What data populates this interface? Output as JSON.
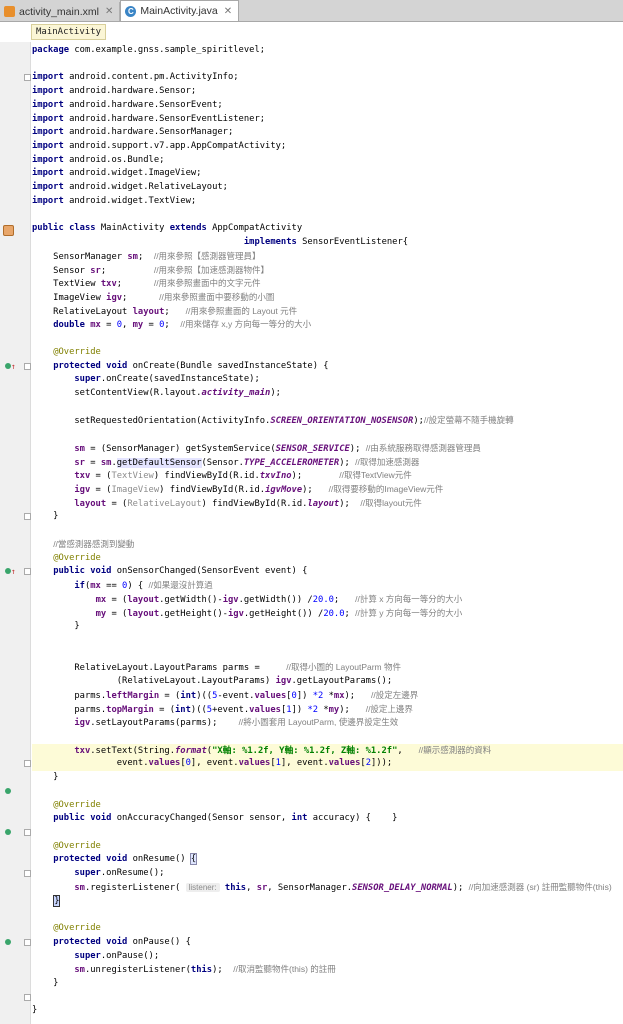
{
  "tabs": [
    {
      "label": "activity_main.xml",
      "icon": "xml-file-icon",
      "active": false
    },
    {
      "label": "MainActivity.java",
      "icon": "java-class-icon",
      "active": true
    }
  ],
  "breadcrumb": "MainActivity",
  "code_lines": [
    [
      {
        "t": "package ",
        "c": "k"
      },
      {
        "t": "com.example.gnss.sample_spiritlevel;"
      }
    ],
    [],
    [
      {
        "t": "import ",
        "c": "k"
      },
      {
        "t": "android.content.pm.ActivityInfo;"
      }
    ],
    [
      {
        "t": "import ",
        "c": "k"
      },
      {
        "t": "android.hardware.Sensor;"
      }
    ],
    [
      {
        "t": "import ",
        "c": "k"
      },
      {
        "t": "android.hardware.SensorEvent;"
      }
    ],
    [
      {
        "t": "import ",
        "c": "k"
      },
      {
        "t": "android.hardware.SensorEventListener;"
      }
    ],
    [
      {
        "t": "import ",
        "c": "k"
      },
      {
        "t": "android.hardware.SensorManager;"
      }
    ],
    [
      {
        "t": "import ",
        "c": "k"
      },
      {
        "t": "android.support.v7.app.AppCompatActivity;"
      }
    ],
    [
      {
        "t": "import ",
        "c": "k"
      },
      {
        "t": "android.os.Bundle;"
      }
    ],
    [
      {
        "t": "import ",
        "c": "k"
      },
      {
        "t": "android.widget.ImageView;"
      }
    ],
    [
      {
        "t": "import ",
        "c": "k"
      },
      {
        "t": "android.widget.RelativeLayout;"
      }
    ],
    [
      {
        "t": "import ",
        "c": "k"
      },
      {
        "t": "android.widget.TextView;"
      }
    ],
    [],
    [
      {
        "t": "public class ",
        "c": "k"
      },
      {
        "t": "MainActivity "
      },
      {
        "t": "extends ",
        "c": "k"
      },
      {
        "t": "AppCompatActivity"
      }
    ],
    [
      {
        "t": "                                        "
      },
      {
        "t": "implements ",
        "c": "k"
      },
      {
        "t": "SensorEventListener{"
      }
    ],
    [
      {
        "t": "    SensorManager "
      },
      {
        "t": "sm",
        "c": "f"
      },
      {
        "t": ";  "
      },
      {
        "t": "//用來參照【感測器管理員】",
        "c": "ch"
      }
    ],
    [
      {
        "t": "    Sensor "
      },
      {
        "t": "sr",
        "c": "f"
      },
      {
        "t": ";         "
      },
      {
        "t": "//用來參照【加速感測器物件】",
        "c": "ch"
      }
    ],
    [
      {
        "t": "    TextView "
      },
      {
        "t": "txv",
        "c": "f"
      },
      {
        "t": ";      "
      },
      {
        "t": "//用來參照畫面中的文字元件",
        "c": "ch"
      }
    ],
    [
      {
        "t": "    ImageView "
      },
      {
        "t": "igv",
        "c": "f"
      },
      {
        "t": ";      "
      },
      {
        "t": "//用來參照畫面中要移動的小圖",
        "c": "ch"
      }
    ],
    [
      {
        "t": "    RelativeLayout "
      },
      {
        "t": "layout",
        "c": "f"
      },
      {
        "t": ";   "
      },
      {
        "t": "//用來參照畫面的 Layout 元件",
        "c": "ch"
      }
    ],
    [
      {
        "t": "    "
      },
      {
        "t": "double ",
        "c": "k"
      },
      {
        "t": "mx",
        "c": "f"
      },
      {
        "t": " = "
      },
      {
        "t": "0",
        "c": "n"
      },
      {
        "t": ", "
      },
      {
        "t": "my",
        "c": "f"
      },
      {
        "t": " = "
      },
      {
        "t": "0",
        "c": "n"
      },
      {
        "t": ";  "
      },
      {
        "t": "//用來儲存 x,y 方向每一等分的大小",
        "c": "ch"
      }
    ],
    [],
    [
      {
        "t": "    "
      },
      {
        "t": "@Override",
        "c": "a"
      }
    ],
    [
      {
        "t": "    "
      },
      {
        "t": "protected void ",
        "c": "k"
      },
      {
        "t": "onCreate(Bundle savedInstanceState) {"
      }
    ],
    [
      {
        "t": "        "
      },
      {
        "t": "super",
        "c": "k"
      },
      {
        "t": ".onCreate(savedInstanceState);"
      }
    ],
    [
      {
        "t": "        setContentView(R.layout."
      },
      {
        "t": "activity_main",
        "c": "fi"
      },
      {
        "t": ");"
      }
    ],
    [],
    [
      {
        "t": "        setRequestedOrientation(ActivityInfo."
      },
      {
        "t": "SCREEN_ORIENTATION_NOSENSOR",
        "c": "fi"
      },
      {
        "t": ");"
      },
      {
        "t": "//設定螢幕不隨手機旋轉",
        "c": "ch"
      }
    ],
    [],
    [
      {
        "t": "        "
      },
      {
        "t": "sm",
        "c": "f"
      },
      {
        "t": " = (SensorManager) getSystemService("
      },
      {
        "t": "SENSOR_SERVICE",
        "c": "fi"
      },
      {
        "t": "); "
      },
      {
        "t": "//由系統服務取得感測器管理員",
        "c": "ch"
      }
    ],
    [
      {
        "t": "        "
      },
      {
        "t": "sr",
        "c": "f"
      },
      {
        "t": " = "
      },
      {
        "t": "sm",
        "c": "f"
      },
      {
        "t": "."
      },
      {
        "t": "getDefaultSensor",
        "c": "mhl"
      },
      {
        "t": "(Sensor."
      },
      {
        "t": "TYPE_ACCELEROMETER",
        "c": "fi"
      },
      {
        "t": "); "
      },
      {
        "t": "//取得加速感測器",
        "c": "ch"
      }
    ],
    [
      {
        "t": "        "
      },
      {
        "t": "txv",
        "c": "f"
      },
      {
        "t": " = ("
      },
      {
        "t": "TextView",
        "c": "g"
      },
      {
        "t": ") findViewById(R.id."
      },
      {
        "t": "txvIno",
        "c": "fi"
      },
      {
        "t": ");       "
      },
      {
        "t": "//取得TextView元件",
        "c": "ch"
      }
    ],
    [
      {
        "t": "        "
      },
      {
        "t": "igv",
        "c": "f"
      },
      {
        "t": " = ("
      },
      {
        "t": "ImageView",
        "c": "g"
      },
      {
        "t": ") findViewById(R.id."
      },
      {
        "t": "igvMove",
        "c": "fi"
      },
      {
        "t": ");   "
      },
      {
        "t": "//取得要移動的ImageView元件",
        "c": "ch"
      }
    ],
    [
      {
        "t": "        "
      },
      {
        "t": "layout",
        "c": "f"
      },
      {
        "t": " = ("
      },
      {
        "t": "RelativeLayout",
        "c": "g"
      },
      {
        "t": ") findViewById(R.id."
      },
      {
        "t": "layout",
        "c": "fi"
      },
      {
        "t": ");  "
      },
      {
        "t": "//取得layout元件",
        "c": "ch"
      }
    ],
    [
      {
        "t": "    }"
      }
    ],
    [],
    [
      {
        "t": "    "
      },
      {
        "t": "//當感測器感測到變動",
        "c": "ch"
      }
    ],
    [
      {
        "t": "    "
      },
      {
        "t": "@Override",
        "c": "a"
      }
    ],
    [
      {
        "t": "    "
      },
      {
        "t": "public void ",
        "c": "k"
      },
      {
        "t": "onSensorChanged(SensorEvent event) {"
      }
    ],
    [
      {
        "t": "        "
      },
      {
        "t": "if",
        "c": "k"
      },
      {
        "t": "("
      },
      {
        "t": "mx",
        "c": "f"
      },
      {
        "t": " == "
      },
      {
        "t": "0",
        "c": "n"
      },
      {
        "t": ") { "
      },
      {
        "t": "//如果還沒計算過",
        "c": "ch"
      }
    ],
    [
      {
        "t": "            "
      },
      {
        "t": "mx",
        "c": "f"
      },
      {
        "t": " = ("
      },
      {
        "t": "layout",
        "c": "f"
      },
      {
        "t": ".getWidth()-"
      },
      {
        "t": "igv",
        "c": "f"
      },
      {
        "t": ".getWidth()) /"
      },
      {
        "t": "20.0",
        "c": "n"
      },
      {
        "t": ";   "
      },
      {
        "t": "//計算 x 方向每一等分的大小",
        "c": "ch"
      }
    ],
    [
      {
        "t": "            "
      },
      {
        "t": "my",
        "c": "f"
      },
      {
        "t": " = ("
      },
      {
        "t": "layout",
        "c": "f"
      },
      {
        "t": ".getHeight()-"
      },
      {
        "t": "igv",
        "c": "f"
      },
      {
        "t": ".getHeight()) /"
      },
      {
        "t": "20.0",
        "c": "n"
      },
      {
        "t": "; "
      },
      {
        "t": "//計算 y 方向每一等分的大小",
        "c": "ch"
      }
    ],
    [
      {
        "t": "        }"
      }
    ],
    [],
    [],
    [
      {
        "t": "        RelativeLayout.LayoutParams parms =     "
      },
      {
        "t": "//取得小圖的 LayoutParm 物件",
        "c": "ch"
      }
    ],
    [
      {
        "t": "                (RelativeLayout.LayoutParams) "
      },
      {
        "t": "igv",
        "c": "f"
      },
      {
        "t": ".getLayoutParams();"
      }
    ],
    [
      {
        "t": "        parms."
      },
      {
        "t": "leftMargin",
        "c": "f"
      },
      {
        "t": " = ("
      },
      {
        "t": "int",
        "c": "k"
      },
      {
        "t": ")(("
      },
      {
        "t": "5",
        "c": "n"
      },
      {
        "t": "-event."
      },
      {
        "t": "values",
        "c": "f"
      },
      {
        "t": "["
      },
      {
        "t": "0",
        "c": "n"
      },
      {
        "t": "]) "
      },
      {
        "t": "*2",
        "c": "n"
      },
      {
        "t": " *"
      },
      {
        "t": "mx",
        "c": "f"
      },
      {
        "t": ");   "
      },
      {
        "t": "//設定左邊界",
        "c": "ch"
      }
    ],
    [
      {
        "t": "        parms."
      },
      {
        "t": "topMargin",
        "c": "f"
      },
      {
        "t": " = ("
      },
      {
        "t": "int",
        "c": "k"
      },
      {
        "t": ")(("
      },
      {
        "t": "5",
        "c": "n"
      },
      {
        "t": "+event."
      },
      {
        "t": "values",
        "c": "f"
      },
      {
        "t": "["
      },
      {
        "t": "1",
        "c": "n"
      },
      {
        "t": "]) "
      },
      {
        "t": "*2",
        "c": "n"
      },
      {
        "t": " *"
      },
      {
        "t": "my",
        "c": "f"
      },
      {
        "t": ");   "
      },
      {
        "t": "//設定上邊界",
        "c": "ch"
      }
    ],
    [
      {
        "t": "        "
      },
      {
        "t": "igv",
        "c": "f"
      },
      {
        "t": ".setLayoutParams(parms);    "
      },
      {
        "t": "//將小圖套用 LayoutParm, 使邊界設定生效",
        "c": "ch"
      }
    ],
    [],
    [
      {
        "t": "        "
      },
      {
        "t": "txv",
        "c": "f"
      },
      {
        "t": ".setText(String."
      },
      {
        "t": "format",
        "c": "fi"
      },
      {
        "t": "("
      },
      {
        "t": "\"X軸: %1.2f, Y軸: %1.2f, Z軸: %1.2f\"",
        "c": "s"
      },
      {
        "t": ",   "
      },
      {
        "t": "//顯示感測器的資料",
        "c": "ch"
      }
    ],
    [
      {
        "t": "                event."
      },
      {
        "t": "values",
        "c": "f"
      },
      {
        "t": "["
      },
      {
        "t": "0",
        "c": "n"
      },
      {
        "t": "], event."
      },
      {
        "t": "values",
        "c": "f"
      },
      {
        "t": "["
      },
      {
        "t": "1",
        "c": "n"
      },
      {
        "t": "], event."
      },
      {
        "t": "values",
        "c": "f"
      },
      {
        "t": "["
      },
      {
        "t": "2",
        "c": "n"
      },
      {
        "t": "]));"
      }
    ],
    [
      {
        "t": "    }"
      }
    ],
    [],
    [
      {
        "t": "    "
      },
      {
        "t": "@Override",
        "c": "a"
      }
    ],
    [
      {
        "t": "    "
      },
      {
        "t": "public void ",
        "c": "k"
      },
      {
        "t": "onAccuracyChanged(Sensor sensor, "
      },
      {
        "t": "int ",
        "c": "k"
      },
      {
        "t": "accuracy) {    }"
      }
    ],
    [],
    [
      {
        "t": "    "
      },
      {
        "t": "@Override",
        "c": "a"
      }
    ],
    [
      {
        "t": "    "
      },
      {
        "t": "protected void ",
        "c": "k"
      },
      {
        "t": "onResume() "
      },
      {
        "t": "{",
        "c": "bm"
      }
    ],
    [
      {
        "t": "        "
      },
      {
        "t": "super",
        "c": "k"
      },
      {
        "t": ".onResume();"
      }
    ],
    [
      {
        "t": "        "
      },
      {
        "t": "sm",
        "c": "f"
      },
      {
        "t": ".registerListener( "
      },
      {
        "t": "listener:",
        "c": "hint"
      },
      {
        "t": " "
      },
      {
        "t": "this",
        "c": "k"
      },
      {
        "t": ", "
      },
      {
        "t": "sr",
        "c": "f"
      },
      {
        "t": ", SensorManager."
      },
      {
        "t": "SENSOR_DELAY_NORMAL",
        "c": "fi"
      },
      {
        "t": "); "
      },
      {
        "t": "//向加速感測器 (sr) 註冊監聽物件(this)",
        "c": "ch"
      }
    ],
    [
      {
        "t": "    "
      },
      {
        "t": "}",
        "c": "caret-box"
      }
    ],
    [],
    [
      {
        "t": "    "
      },
      {
        "t": "@Override",
        "c": "a"
      }
    ],
    [
      {
        "t": "    "
      },
      {
        "t": "protected void ",
        "c": "k"
      },
      {
        "t": "onPause() {"
      }
    ],
    [
      {
        "t": "        "
      },
      {
        "t": "super",
        "c": "k"
      },
      {
        "t": ".onPause();"
      }
    ],
    [
      {
        "t": "        "
      },
      {
        "t": "sm",
        "c": "f"
      },
      {
        "t": ".unregisterListener("
      },
      {
        "t": "this",
        "c": "k"
      },
      {
        "t": ");  "
      },
      {
        "t": "//取消監聽物件(this) 的註冊",
        "c": "ch"
      }
    ],
    [
      {
        "t": "    }"
      }
    ],
    [],
    [
      {
        "t": "}"
      }
    ]
  ]
}
